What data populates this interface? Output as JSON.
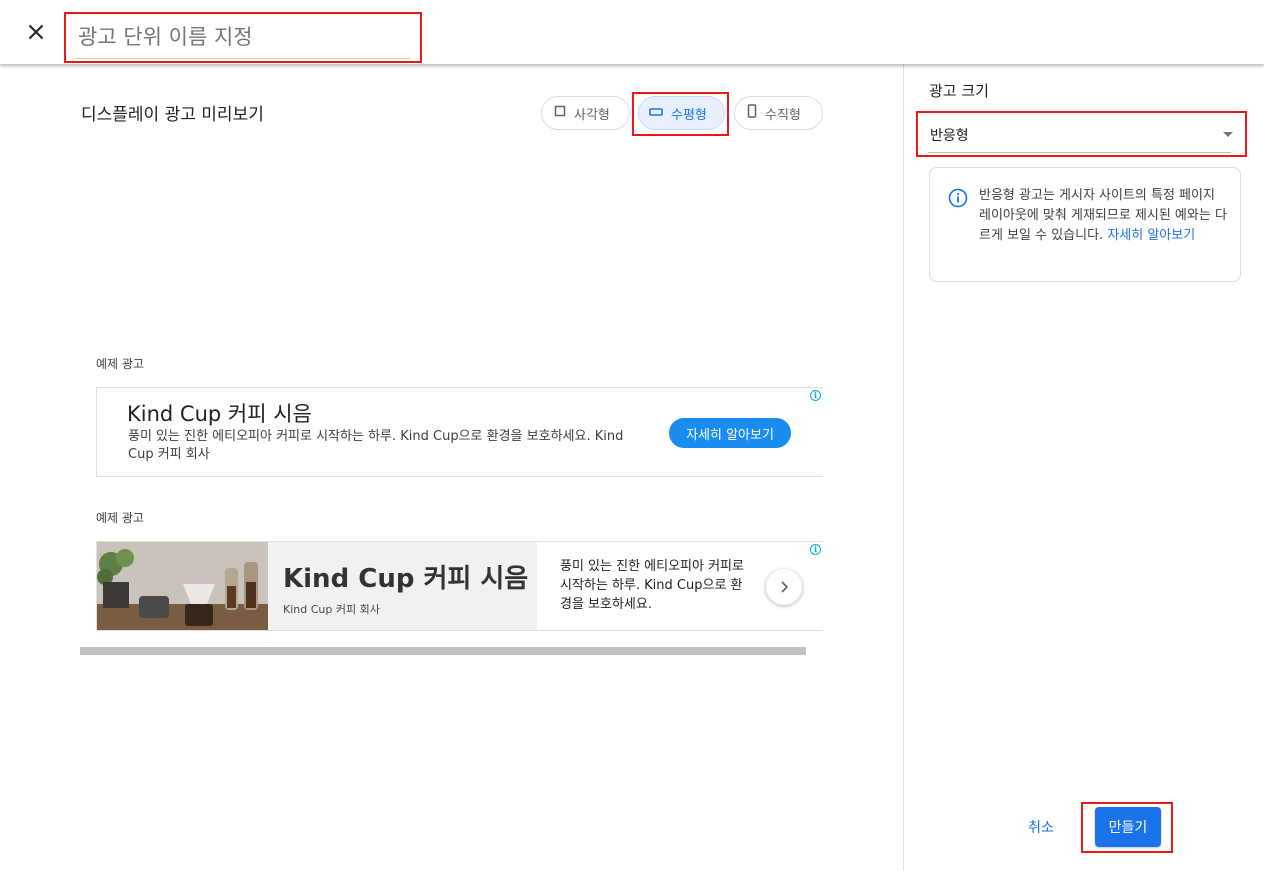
{
  "header": {
    "close_icon": "close-icon",
    "ad_unit_name_placeholder": "광고 단위 이름 지정"
  },
  "preview": {
    "title": "디스플레이 광고 미리보기",
    "shape_toggles": [
      {
        "label": "사각형",
        "icon": "square-icon",
        "selected": false
      },
      {
        "label": "수평형",
        "icon": "horizontal-rect-icon",
        "selected": true
      },
      {
        "label": "수직형",
        "icon": "vertical-rect-icon",
        "selected": false
      }
    ],
    "sample_ads": [
      {
        "label": "예제 광고",
        "title": "Kind Cup 커피 시음",
        "description": "풍미 있는 진한 에티오피아 커피로 시작하는 하루. Kind Cup으로 환경을 보호하세요. Kind Cup 커피 회사",
        "cta": "자세히 알아보기"
      },
      {
        "label": "예제 광고",
        "title": "Kind Cup 커피 시음",
        "company": "Kind Cup 커피 회사",
        "description": "풍미 있는 진한 에티오피아 커피로 시작하는 하루. Kind Cup으로 환경을 보호하세요."
      }
    ]
  },
  "sidebar": {
    "size_label": "광고 크기",
    "size_value": "반응형",
    "info_text": "반응형 광고는 게시자 사이트의 특정 페이지 레이아웃에 맞춰 게재되므로 제시된 예와는 다르게 보일 수 있습니다.",
    "info_link": "자세히 알아보기"
  },
  "footer": {
    "cancel_label": "취소",
    "create_label": "만들기"
  },
  "colors": {
    "accent": "#1a73e8",
    "highlight": "#e51a1a",
    "ad_cta": "#1a8cf0"
  }
}
